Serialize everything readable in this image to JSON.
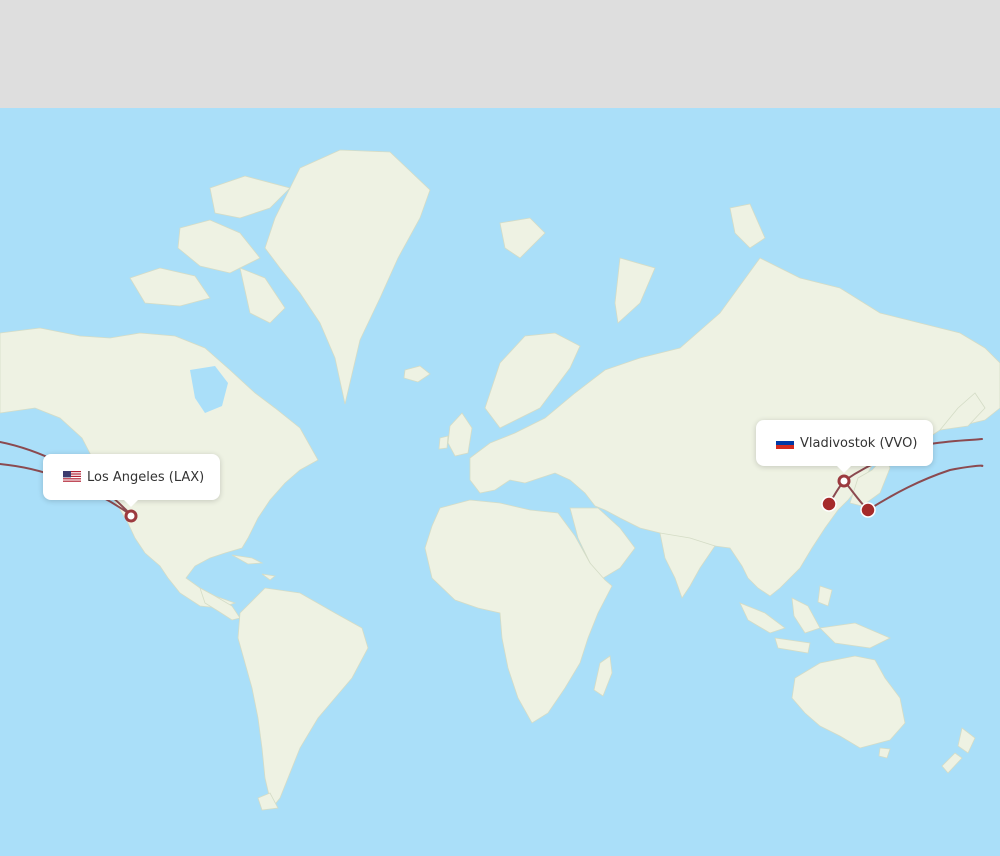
{
  "airports": {
    "origin": {
      "label": "Los Angeles (LAX)",
      "flag": "us-flag-icon"
    },
    "destination": {
      "label": "Vladivostok (VVO)",
      "flag": "ru-flag-icon"
    }
  },
  "colors": {
    "water": "#aadff9",
    "land": "#eef2e3",
    "route": "#8b4a50",
    "airport_marker": "#a52a2a",
    "header_band": "#dedede"
  }
}
